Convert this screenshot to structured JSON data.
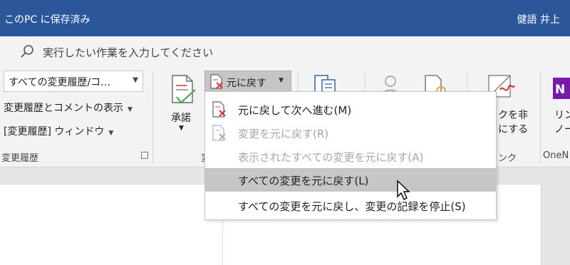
{
  "titlebar": {
    "doc_title": "このPC に保存済み",
    "user_name": "健語 井上"
  },
  "tellme": {
    "placeholder": "実行したい作業を入力してください"
  },
  "review_group": {
    "markup_dropdown": "すべての変更履歴/コ…",
    "show_markup": "変更履歴とコメントの表示",
    "reviewing_pane": "[変更履歴] ウィンドウ",
    "group_label": "変更履歴"
  },
  "accept": {
    "label": "承諾"
  },
  "undo_button": {
    "label": "元に戻す"
  },
  "partial_labels": {
    "group2_fragment": "変",
    "ink_line1": "クを非",
    "ink_line2": "にする",
    "ink_group": "ンク",
    "linked_notes_line1": "リン",
    "linked_notes_line2": "ノー",
    "onenote_group": "OneN"
  },
  "menu": {
    "items": [
      {
        "label": "元に戻して次へ進む(M)",
        "enabled": true,
        "icon": "reject-next-icon"
      },
      {
        "label": "変更を元に戻す(R)",
        "enabled": false,
        "icon": "reject-change-icon"
      },
      {
        "label": "表示されたすべての変更を元に戻す(A)",
        "enabled": false,
        "icon": ""
      },
      {
        "label": "すべての変更を元に戻す(L)",
        "enabled": true,
        "icon": ""
      },
      {
        "label": "すべての変更を元に戻し、変更の記録を停止(S)",
        "enabled": true,
        "icon": ""
      }
    ]
  },
  "colors": {
    "title_bar": "#2b579a",
    "ribbon": "#f3f3f3",
    "hover": "#c6c6c6",
    "reject_red": "#d13438",
    "onenote_purple": "#7719aa"
  }
}
